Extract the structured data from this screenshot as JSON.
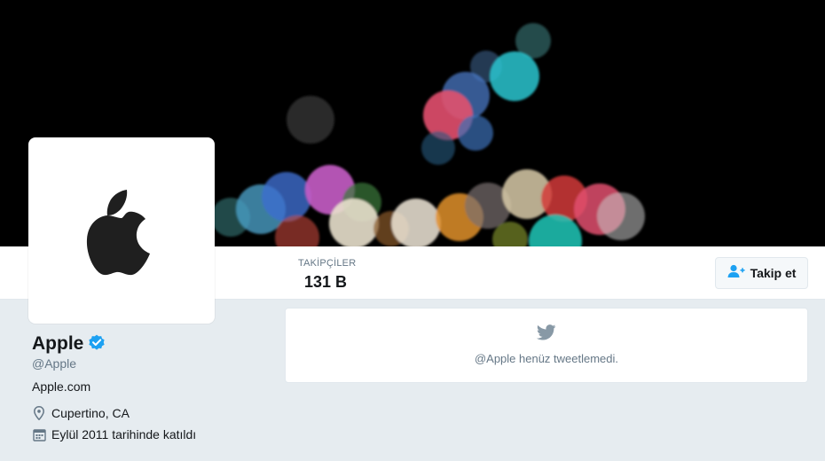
{
  "profile": {
    "name": "Apple",
    "handle": "@Apple",
    "url": "Apple.com",
    "location": "Cupertino, CA",
    "joined": "Eylül 2011 tarihinde katıldı",
    "verified": true
  },
  "stats": {
    "followers_label": "TAKİPÇİLER",
    "followers_value": "131 B"
  },
  "actions": {
    "follow_label": "Takip et"
  },
  "timeline": {
    "empty_message": "@Apple henüz tweetlemedi."
  },
  "icons": {
    "verified": "verified-badge-icon",
    "location": "location-pin-icon",
    "calendar": "calendar-icon",
    "follow": "add-user-icon",
    "bird": "twitter-bird-icon",
    "logo": "apple-logo-icon"
  },
  "colors": {
    "accent": "#1da1f2",
    "verified": "#1da1f2",
    "background": "#e6ecf0",
    "muted_text": "#657786"
  }
}
